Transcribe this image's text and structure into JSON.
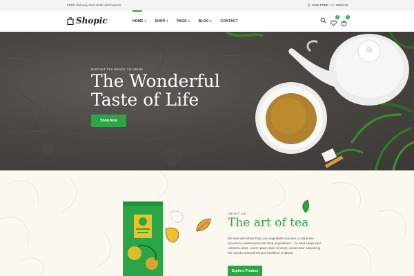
{
  "topbar": {
    "promo": "FREE Delivery Over $100 All Products",
    "join": "JOIN FREE",
    "or": "OR",
    "signin": "SIGN IN"
  },
  "header": {
    "logo": "Shopic",
    "nav": [
      "HOME",
      "SHOP",
      "PAGE",
      "BLOG",
      "CONTACT"
    ],
    "nav_suffix": [
      "+",
      "+",
      "+",
      "+",
      ""
    ],
    "wishlist_count": "0",
    "cart_count": "0"
  },
  "hero": {
    "kicker": "INSTANT TEA READY TO DRINK",
    "title_line1": "The Wonderful",
    "title_line2": "Taste of Life",
    "button": "Shop Now"
  },
  "about": {
    "kicker": "ABOUT US",
    "heading": "The art of tea",
    "body": "We start with whole fruits and vegetables and use a cold-press process to extract every last drop of goodness – no heat keeps your nutrients intact. Lorem ipsum dolor sit amet, consectetur adipisicing elit, sed do eiusmod tempor incididunt ut labore.",
    "button": "Explore Product"
  },
  "colors": {
    "brand_green": "#2aa646",
    "hero_bg": "#4a4743",
    "page_bg": "#fbf8ef"
  },
  "icons": [
    "user-icon",
    "shopping-bag-icon",
    "search-icon",
    "heart-icon",
    "cart-icon"
  ]
}
